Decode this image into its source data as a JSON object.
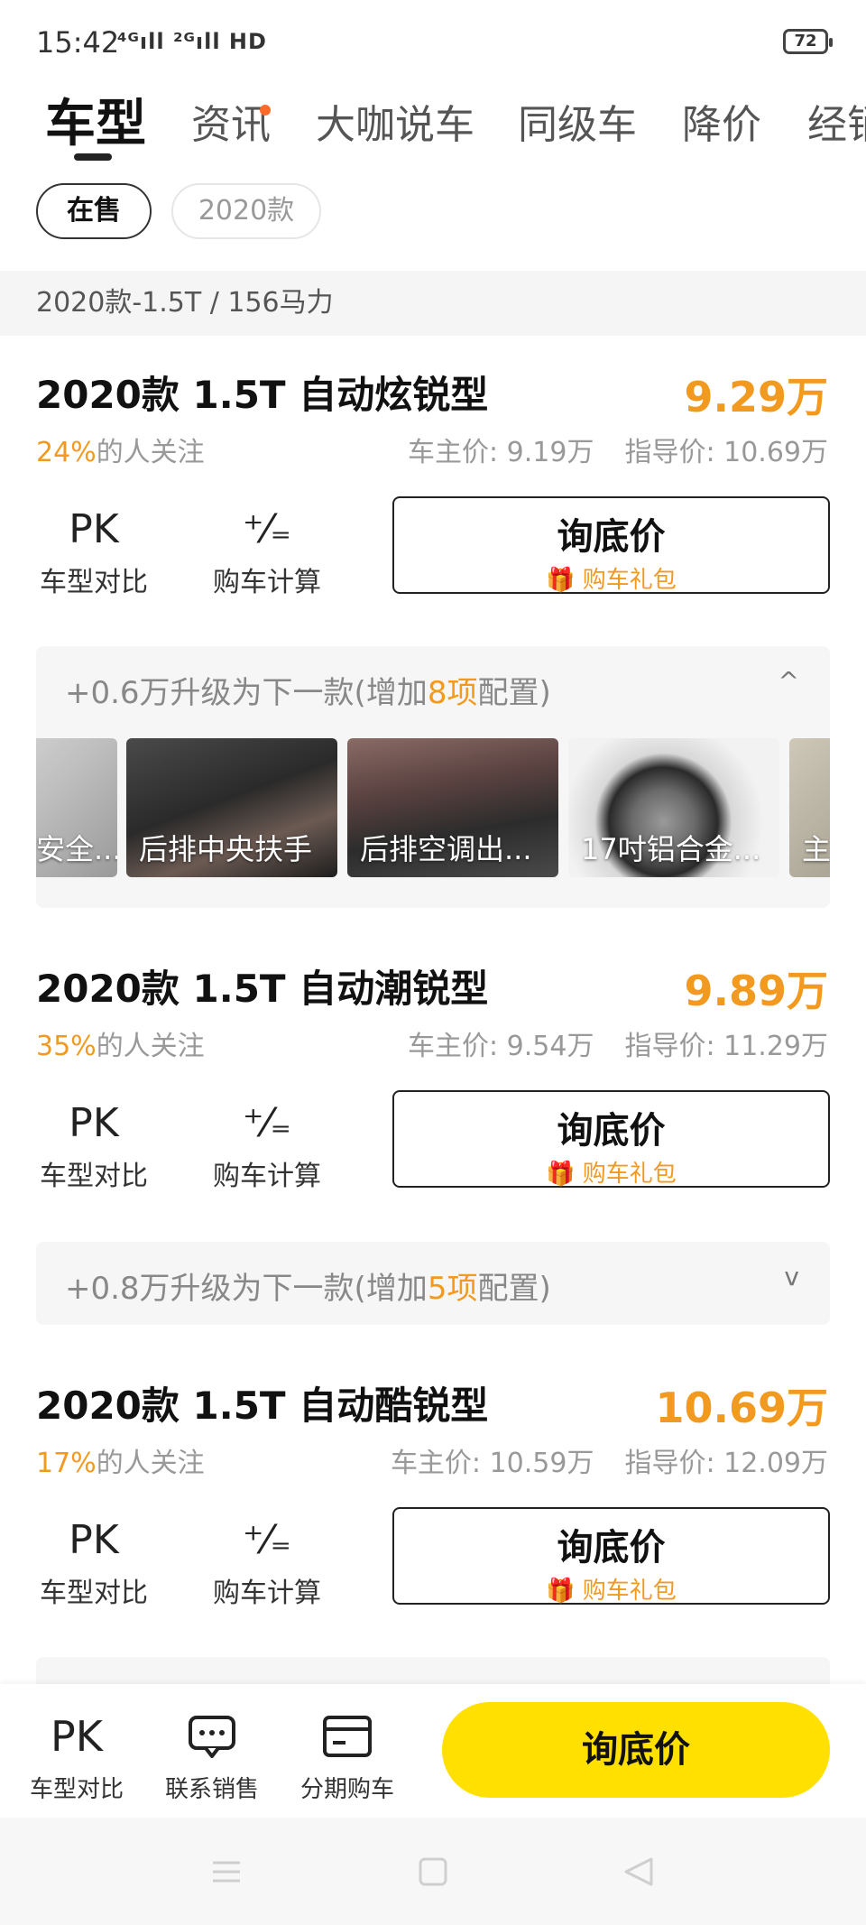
{
  "status_bar": {
    "time": "15:42",
    "signal": "⁴ᴳıll ²ᴳıll HD",
    "battery": "72"
  },
  "tabs": [
    {
      "label": "车型"
    },
    {
      "label": "资讯"
    },
    {
      "label": "大咖说车"
    },
    {
      "label": "同级车"
    },
    {
      "label": "降价"
    },
    {
      "label": "经销商"
    }
  ],
  "filters": [
    {
      "label": "在售"
    },
    {
      "label": "2020款"
    }
  ],
  "group_header": "2020款-1.5T / 156马力",
  "cards": [
    {
      "title": "2020款 1.5T 自动炫锐型",
      "price": "9.29万",
      "attention_pct": "24%",
      "attention_text": "的人关注",
      "owner_price": "车主价: 9.19万",
      "guide_price": "指导价: 10.69万",
      "pk_icon": "PK",
      "pk_label": "车型对比",
      "calc_icon": "⁺⁄₌",
      "calc_label": "购车计算",
      "ask_title": "询底价",
      "ask_sub": "🎁 购车礼包",
      "upgrade": {
        "prefix": "+0.6万升级为下一款(增加",
        "count": "8项",
        "suffix": "配置)",
        "chevron": "^"
      },
      "features": [
        "安全...",
        "后排中央扶手",
        "后排空调出...",
        "17吋铝合金...",
        "主"
      ]
    },
    {
      "title": "2020款 1.5T 自动潮锐型",
      "price": "9.89万",
      "attention_pct": "35%",
      "attention_text": "的人关注",
      "owner_price": "车主价: 9.54万",
      "guide_price": "指导价: 11.29万",
      "pk_icon": "PK",
      "pk_label": "车型对比",
      "calc_icon": "⁺⁄₌",
      "calc_label": "购车计算",
      "ask_title": "询底价",
      "ask_sub": "🎁 购车礼包",
      "upgrade": {
        "prefix": "+0.8万升级为下一款(增加",
        "count": "5项",
        "suffix": "配置)",
        "chevron": "v"
      }
    },
    {
      "title": "2020款 1.5T 自动酷锐型",
      "price": "10.69万",
      "attention_pct": "17%",
      "attention_text": "的人关注",
      "owner_price": "车主价: 10.59万",
      "guide_price": "指导价: 12.09万",
      "pk_icon": "PK",
      "pk_label": "车型对比",
      "calc_icon": "⁺⁄₌",
      "calc_label": "购车计算",
      "ask_title": "询底价",
      "ask_sub": "🎁 购车礼包"
    }
  ],
  "bottom_bar": {
    "compare_icon": "PK",
    "compare_label": "车型对比",
    "contact_icon": "···",
    "contact_label": "联系销售",
    "finance_label": "分期购车",
    "ask_label": "询底价"
  },
  "colors": {
    "accent": "#f29a1f",
    "cta": "#ffe000",
    "dot": "#ff6a2a"
  }
}
